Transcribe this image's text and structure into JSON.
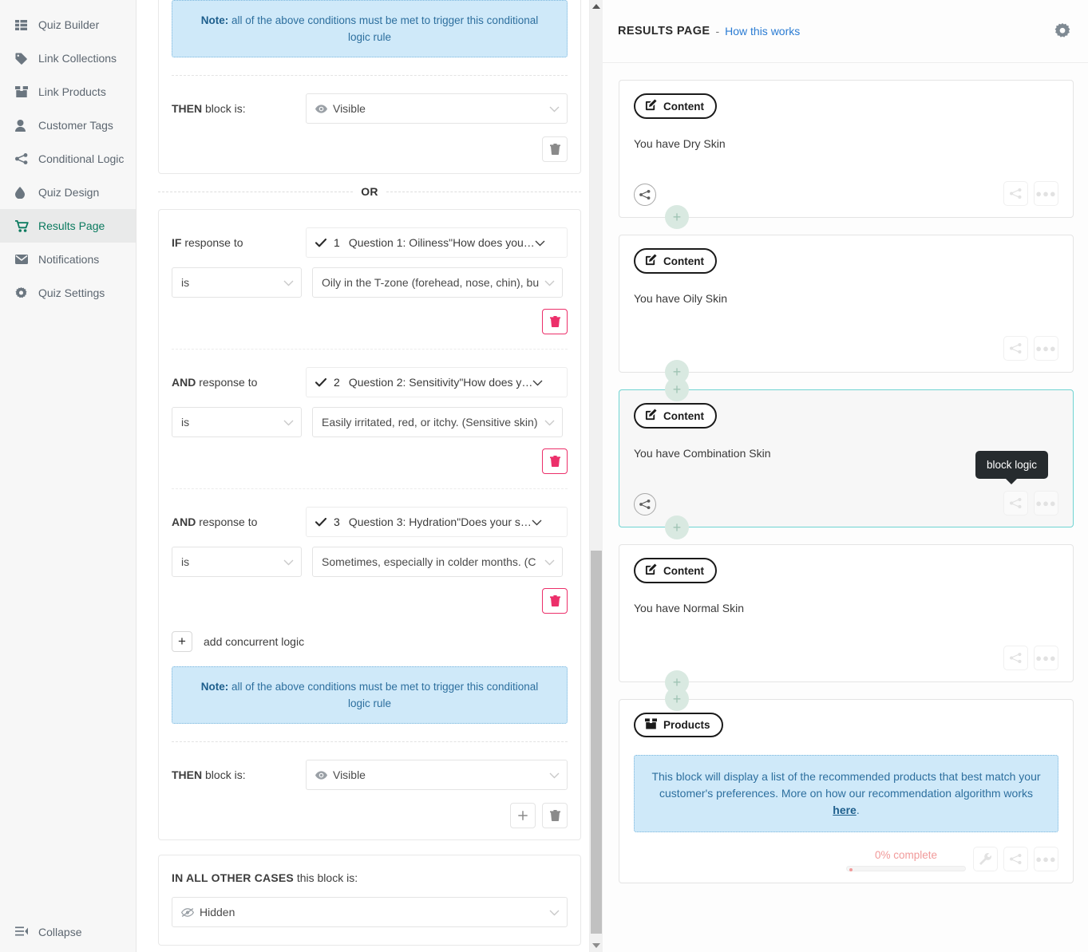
{
  "sidebar": {
    "items": [
      {
        "label": "Quiz Builder",
        "icon": "list-grid-icon",
        "active": false
      },
      {
        "label": "Link Collections",
        "icon": "tag-icon",
        "active": false
      },
      {
        "label": "Link Products",
        "icon": "box-icon",
        "active": false
      },
      {
        "label": "Customer Tags",
        "icon": "user-icon",
        "active": false
      },
      {
        "label": "Conditional Logic",
        "icon": "share-nodes-icon",
        "active": false
      },
      {
        "label": "Quiz Design",
        "icon": "droplet-icon",
        "active": false
      },
      {
        "label": "Results Page",
        "icon": "cart-icon",
        "active": true
      },
      {
        "label": "Notifications",
        "icon": "envelope-icon",
        "active": false
      },
      {
        "label": "Quiz Settings",
        "icon": "gear-icon",
        "active": false
      }
    ],
    "collapse_label": "Collapse",
    "collapse_icon": "collapse-icon",
    "active_color": "#0b7a5f"
  },
  "logic": {
    "rule_top": {
      "note_prefix": "Note:",
      "note_text": " all of the above conditions must be met to trigger this conditional logic rule",
      "then_label_bold": "THEN",
      "then_label_rest": " block is:",
      "then_value": "Visible",
      "then_icon": "eye-icon",
      "delete_icon": "trash-icon"
    },
    "or_text": "OR",
    "rule_bottom": {
      "conditions": [
        {
          "prefix_bold": "IF",
          "prefix_rest": " response to",
          "question_num": "1",
          "question_text": "Question 1: Oiliness\"How does you…",
          "operator": "is",
          "answer": "Oily in the T-zone (forehead, nose, chin), bu",
          "check_icon": "check-icon",
          "delete_icon": "trash-icon"
        },
        {
          "prefix_bold": "AND",
          "prefix_rest": " response to",
          "question_num": "2",
          "question_text": "Question 2: Sensitivity\"How does y…",
          "operator": "is",
          "answer": "Easily irritated, red, or itchy. (Sensitive skin)",
          "check_icon": "check-icon",
          "delete_icon": "trash-icon"
        },
        {
          "prefix_bold": "AND",
          "prefix_rest": " response to",
          "question_num": "3",
          "question_text": "Question 3: Hydration\"Does your s…",
          "operator": "is",
          "answer": "Sometimes, especially in colder months. (C",
          "check_icon": "check-icon",
          "delete_icon": "trash-icon"
        }
      ],
      "add_logic_label": "add concurrent logic",
      "add_logic_icon": "plus-icon",
      "note_prefix": "Note:",
      "note_text": " all of the above conditions must be met to trigger this conditional logic rule",
      "then_label_bold": "THEN",
      "then_label_rest": " block is:",
      "then_value": "Visible",
      "then_icon": "eye-icon",
      "add_icon": "plus-icon",
      "delete_icon": "trash-icon"
    },
    "other_cases": {
      "title_bold": "IN ALL OTHER CASES",
      "title_rest": " this block is:",
      "value": "Hidden",
      "icon": "eye-slash-icon"
    }
  },
  "results_page": {
    "title": "RESULTS PAGE",
    "dash": "-",
    "help_link": "How this works",
    "gear_icon": "gear-icon",
    "add_block_icon": "plus-icon",
    "blocks": [
      {
        "tag": "Content",
        "tag_icon": "edit-square-icon",
        "text": "You have Dry Skin",
        "selected": false,
        "has_circle_logic": true,
        "logic_icon": "block-logic-icon",
        "more_icon": "ellipsis-icon"
      },
      {
        "tag": "Content",
        "tag_icon": "edit-square-icon",
        "text": "You have Oily Skin",
        "selected": false,
        "has_circle_logic": false,
        "logic_icon": "block-logic-icon",
        "more_icon": "ellipsis-icon"
      },
      {
        "tag": "Content",
        "tag_icon": "edit-square-icon",
        "text": "You have Combination Skin",
        "selected": true,
        "has_circle_logic": true,
        "logic_icon": "block-logic-icon",
        "more_icon": "ellipsis-icon",
        "tooltip": "block logic"
      },
      {
        "tag": "Content",
        "tag_icon": "edit-square-icon",
        "text": "You have Normal Skin",
        "selected": false,
        "has_circle_logic": false,
        "logic_icon": "block-logic-icon",
        "more_icon": "ellipsis-icon"
      }
    ],
    "products_block": {
      "tag": "Products",
      "tag_icon": "box-icon",
      "note_text_1": "This block will display a list of the recommended products that best match your customer's preferences. More on how our recommendation algorithm works ",
      "note_link": "here",
      "note_text_2": ".",
      "progress_label": "0% complete",
      "progress_percent": 0,
      "wrench_icon": "wrench-icon",
      "logic_icon": "block-logic-icon",
      "more_icon": "ellipsis-icon"
    }
  },
  "colors": {
    "accent_green": "#0b7a5f",
    "selected_border": "#6fd4d2",
    "danger": "#ec2f6a",
    "link": "#2b7cd3",
    "note_bg": "#cfe9f9",
    "note_text": "#2d6f9e",
    "progress": "#f19a9a"
  }
}
